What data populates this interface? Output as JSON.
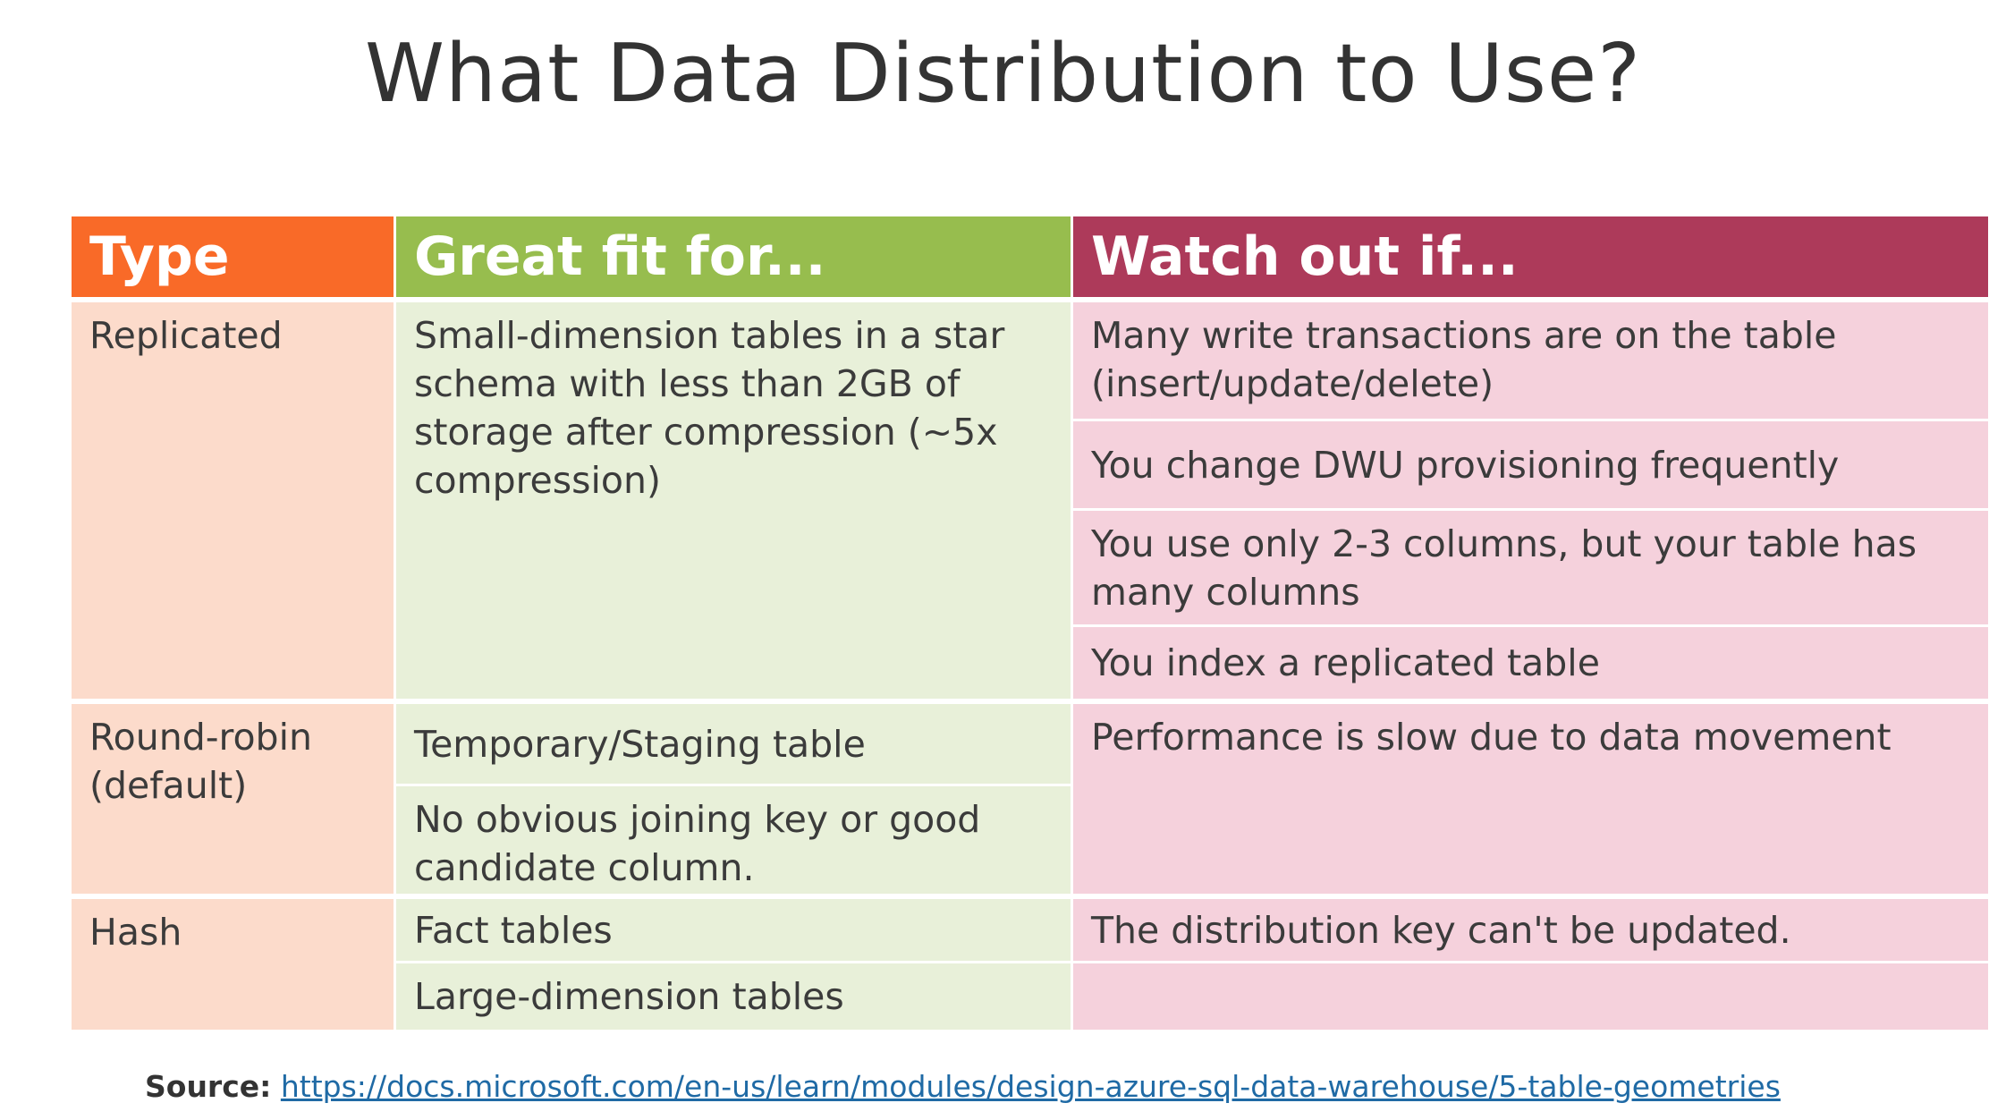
{
  "title": "What Data Distribution to Use?",
  "table": {
    "headers": [
      "Type",
      "Great fit for...",
      "Watch out if..."
    ],
    "replicated": {
      "type": "Replicated",
      "fit": "Small-dimension tables in a star schema with less than 2GB of storage after compression (~5x compression)",
      "watch": [
        "Many write transactions are on the table (insert/update/delete)",
        "You change DWU provisioning frequently",
        "You use only 2-3 columns, but your table has many columns",
        "You index a replicated table"
      ]
    },
    "round_robin": {
      "type": "Round-robin (default)",
      "fit": [
        "Temporary/Staging table",
        "No obvious joining key or good candidate column."
      ],
      "watch": "Performance is slow due to data movement"
    },
    "hash": {
      "type": "Hash",
      "fit": [
        "Fact tables",
        "Large-dimension tables"
      ],
      "watch": "The distribution key can't be updated."
    }
  },
  "source": {
    "label": "Source:",
    "url": "https://docs.microsoft.com/en-us/learn/modules/design-azure-sql-data-warehouse/5-table-geometries"
  },
  "colors": {
    "type_header": "#f96a28",
    "fit_header": "#97bd4e",
    "watch_header": "#ad3a5a",
    "type_cell": "#fcdbcb",
    "fit_cell": "#e8f0d9",
    "watch_cell": "#f5d1dc",
    "link": "#1f6aa5"
  }
}
